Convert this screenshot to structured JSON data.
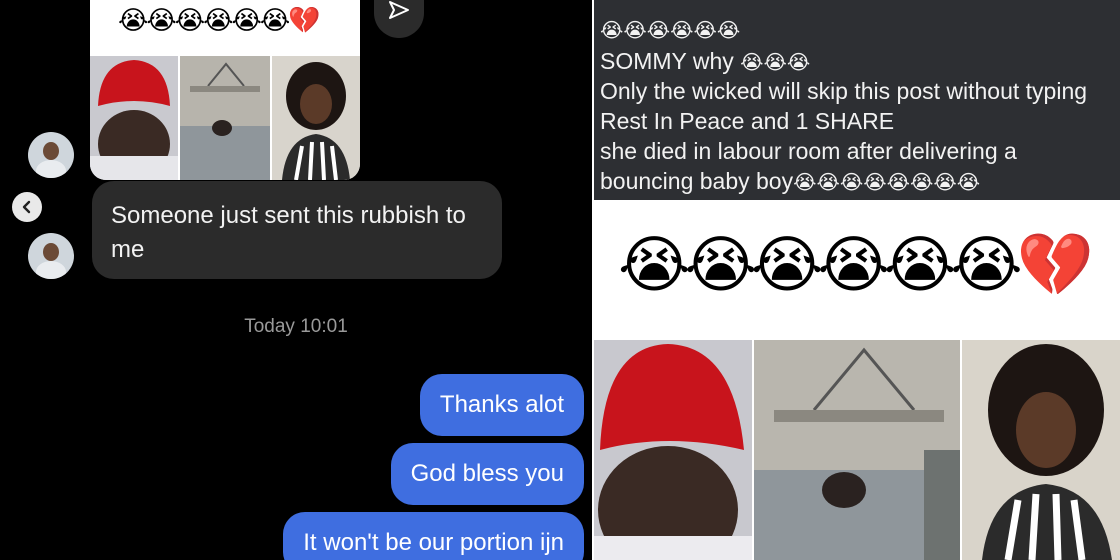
{
  "chat": {
    "shared_post_emojis": "😭😭😭😭😭😭💔",
    "incoming_message": "Someone just sent this rubbish to me",
    "timestamp": "Today 10:01",
    "outgoing_messages": [
      "Thanks alot",
      "God bless you",
      "It won't be our portion ijn"
    ]
  },
  "post": {
    "emoji_line": "😭😭😭😭😭😭",
    "line1_text": "SOMMY why ",
    "line1_emojis": "😭😭😭",
    "line2": "Only the wicked will skip this post without typing",
    "line3": "Rest In Peace and 1 SHARE",
    "line4": "she died in labour room after delivering a",
    "line5_text": "bouncing baby boy",
    "line5_emojis": "😭😭😭😭😭😭😭😭",
    "big_emojis": "😭😭😭😭😭😭💔"
  },
  "colors": {
    "chat_background": "#000000",
    "incoming_bubble": "#2b2b2b",
    "outgoing_bubble": "#3f6ee0",
    "post_background": "#2d2f33"
  },
  "icons": [
    "send-arrow-icon",
    "back-chevron-icon"
  ]
}
